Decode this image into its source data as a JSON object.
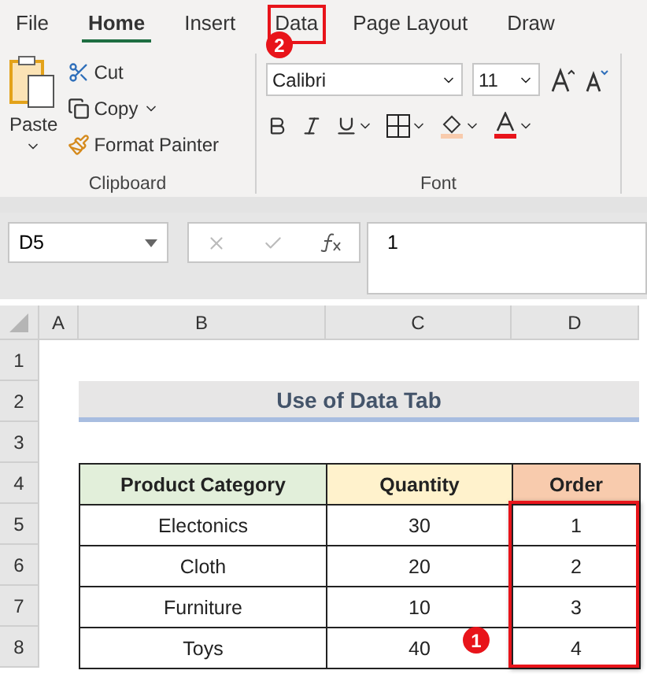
{
  "ribbon_tabs": [
    {
      "label": "File",
      "selected": false,
      "marked": false
    },
    {
      "label": "Home",
      "selected": true,
      "marked": false
    },
    {
      "label": "Insert",
      "selected": false,
      "marked": false
    },
    {
      "label": "Data",
      "selected": false,
      "marked": true
    },
    {
      "label": "Page Layout",
      "selected": false,
      "marked": false
    },
    {
      "label": "Draw",
      "selected": false,
      "marked": false
    }
  ],
  "step_badges": [
    {
      "number": "2"
    },
    {
      "number": "1"
    }
  ],
  "clipboard": {
    "paste": "Paste",
    "cut": "Cut",
    "copy": "Copy",
    "format_painter": "Format Painter",
    "group_label": "Clipboard"
  },
  "font": {
    "font_name": "Calibri",
    "font_size": "11",
    "group_label": "Font"
  },
  "formula_bar": {
    "name_box": "D5",
    "formula": "1"
  },
  "sheet": {
    "columns": [
      "A",
      "B",
      "C",
      "D"
    ],
    "rows": [
      "1",
      "2",
      "3",
      "4",
      "5",
      "6",
      "7",
      "8"
    ],
    "title": "Use of Data Tab",
    "table_headers": [
      {
        "label": "Product Category",
        "color": "#e2efda"
      },
      {
        "label": "Quantity",
        "color": "#fff2cc"
      },
      {
        "label": "Order",
        "color": "#f8cbad"
      }
    ],
    "table_rows": [
      [
        "Electonics",
        "30",
        "1"
      ],
      [
        "Cloth",
        "20",
        "2"
      ],
      [
        "Furniture",
        "10",
        "3"
      ],
      [
        "Toys",
        "40",
        "4"
      ]
    ]
  }
}
